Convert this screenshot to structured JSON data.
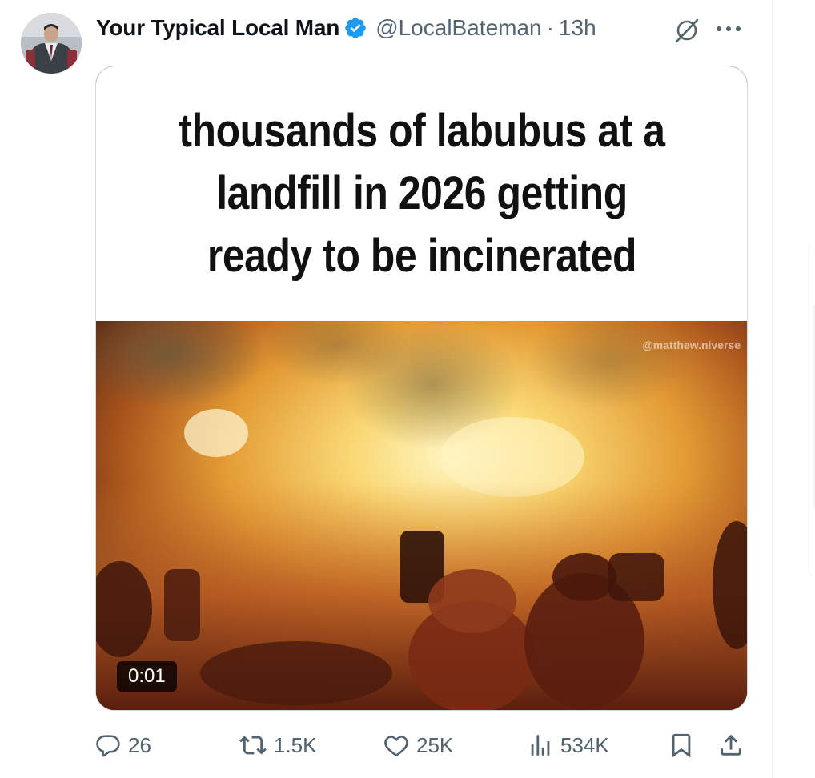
{
  "tweet": {
    "display_name": "Your Typical Local Man",
    "handle": "@LocalBateman",
    "separator": "·",
    "time": "13h",
    "verified_color": "#1d9bf0"
  },
  "media": {
    "caption": "thousands of labubus at a landfill in 2026 getting ready to be incinerated",
    "watermark": "@matthew.niverse",
    "video_timestamp": "0:01"
  },
  "actions": {
    "replies": "26",
    "reposts": "1.5K",
    "likes": "25K",
    "views": "534K"
  },
  "icons": {
    "grok": "grok-icon",
    "more": "more-icon",
    "reply": "reply-icon",
    "repost": "repost-icon",
    "like": "heart-icon",
    "views": "views-icon",
    "bookmark": "bookmark-icon",
    "share": "share-icon"
  },
  "colors": {
    "text_primary": "#0f1419",
    "text_secondary": "#536471",
    "border": "#cfd9de"
  }
}
